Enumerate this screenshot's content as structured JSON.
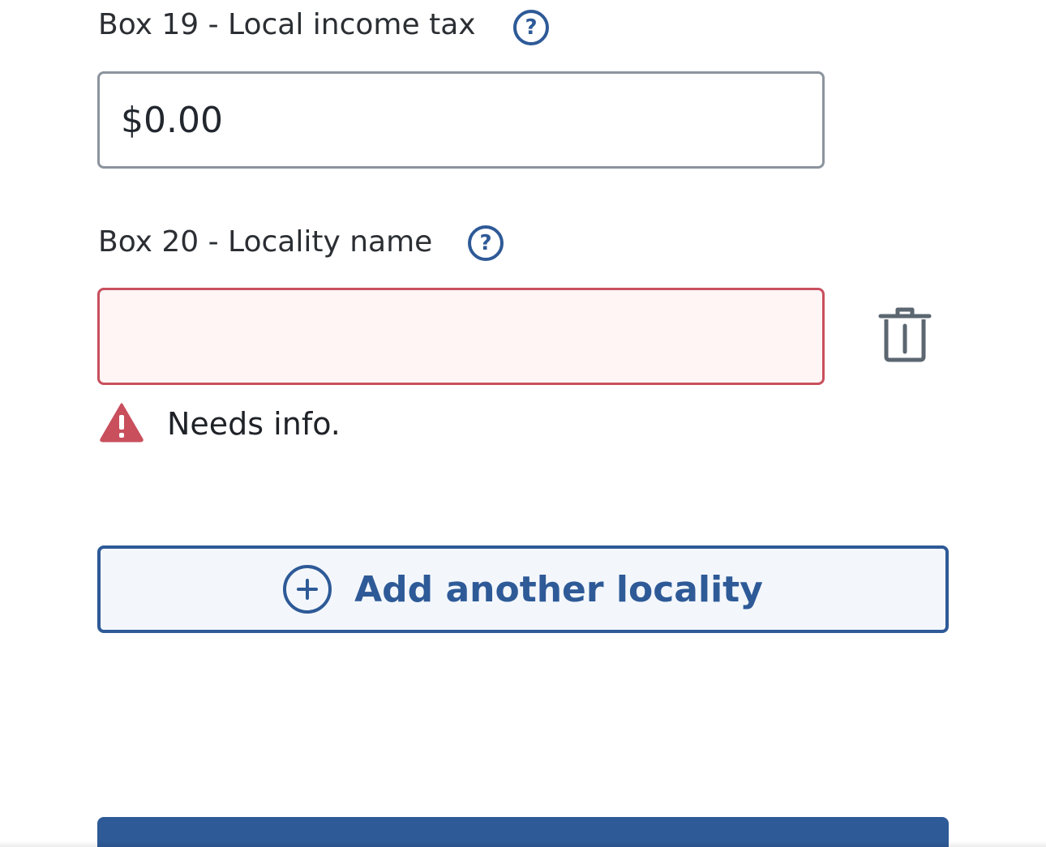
{
  "box19": {
    "label": "Box 19 - Local income tax",
    "help_glyph": "?",
    "value": "$0.00"
  },
  "box20": {
    "label": "Box 20 - Locality name",
    "help_glyph": "?",
    "value": "",
    "error": "Needs info."
  },
  "add_locality": {
    "label": "Add another locality"
  },
  "colors": {
    "primary": "#2e5a97",
    "error": "#c94f5d",
    "error_bg": "#fff5f5"
  },
  "icons": [
    "help-icon",
    "trash-icon",
    "warning-icon",
    "plus-circle-icon"
  ]
}
